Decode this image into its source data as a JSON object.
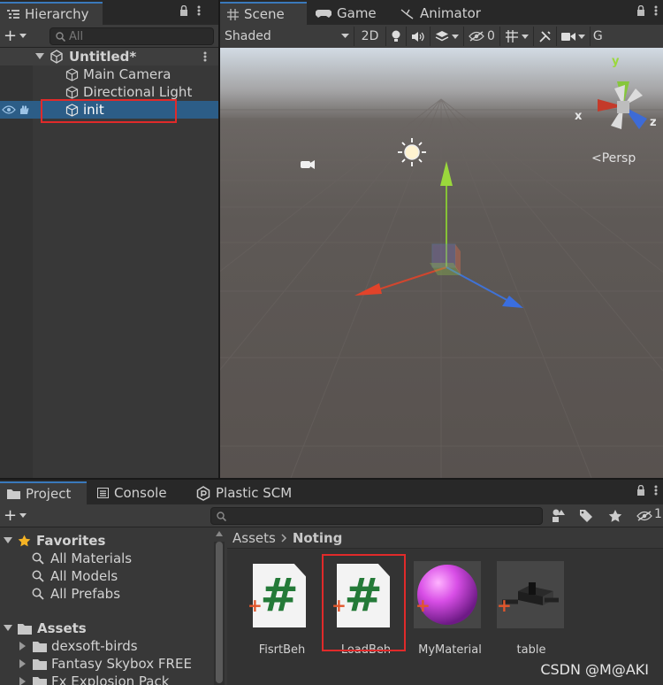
{
  "hierarchy": {
    "tab": "Hierarchy",
    "search_placeholder": "All",
    "scene_name": "Untitled*",
    "objects": [
      "Main Camera",
      "Directional Light",
      "init"
    ]
  },
  "scene_view": {
    "tabs": [
      "Scene",
      "Game",
      "Animator"
    ],
    "shading_mode": "Shaded",
    "mode_2d": "2D",
    "hidden_count": "0",
    "gizmo_cut": "G",
    "projection": "<Persp",
    "axes": {
      "x": "x",
      "y": "y",
      "z": "z"
    }
  },
  "project": {
    "tabs": [
      "Project",
      "Console",
      "Plastic SCM"
    ],
    "favorites_label": "Favorites",
    "favorites": [
      "All Materials",
      "All Models",
      "All Prefabs"
    ],
    "assets_label": "Assets",
    "folders": [
      "dexsoft-birds",
      "Fantasy Skybox FREE",
      "Fx Explosion Pack"
    ],
    "breadcrumb": [
      "Assets",
      "Noting"
    ],
    "hidden_count": "1",
    "assets": [
      {
        "name": "FisrtBeh",
        "icon": "csharp-script-icon"
      },
      {
        "name": "LoadBeh",
        "icon": "csharp-script-icon"
      },
      {
        "name": "MyMaterial",
        "icon": "material-sphere-icon"
      },
      {
        "name": "table",
        "icon": "prefab-model-icon"
      }
    ]
  },
  "watermark": "CSDN @M@AKI",
  "colors": {
    "selection": "#2c5d87",
    "highlight_box": "#e02a2a",
    "script_hash": "#247a38",
    "material": "#d84ee6"
  }
}
